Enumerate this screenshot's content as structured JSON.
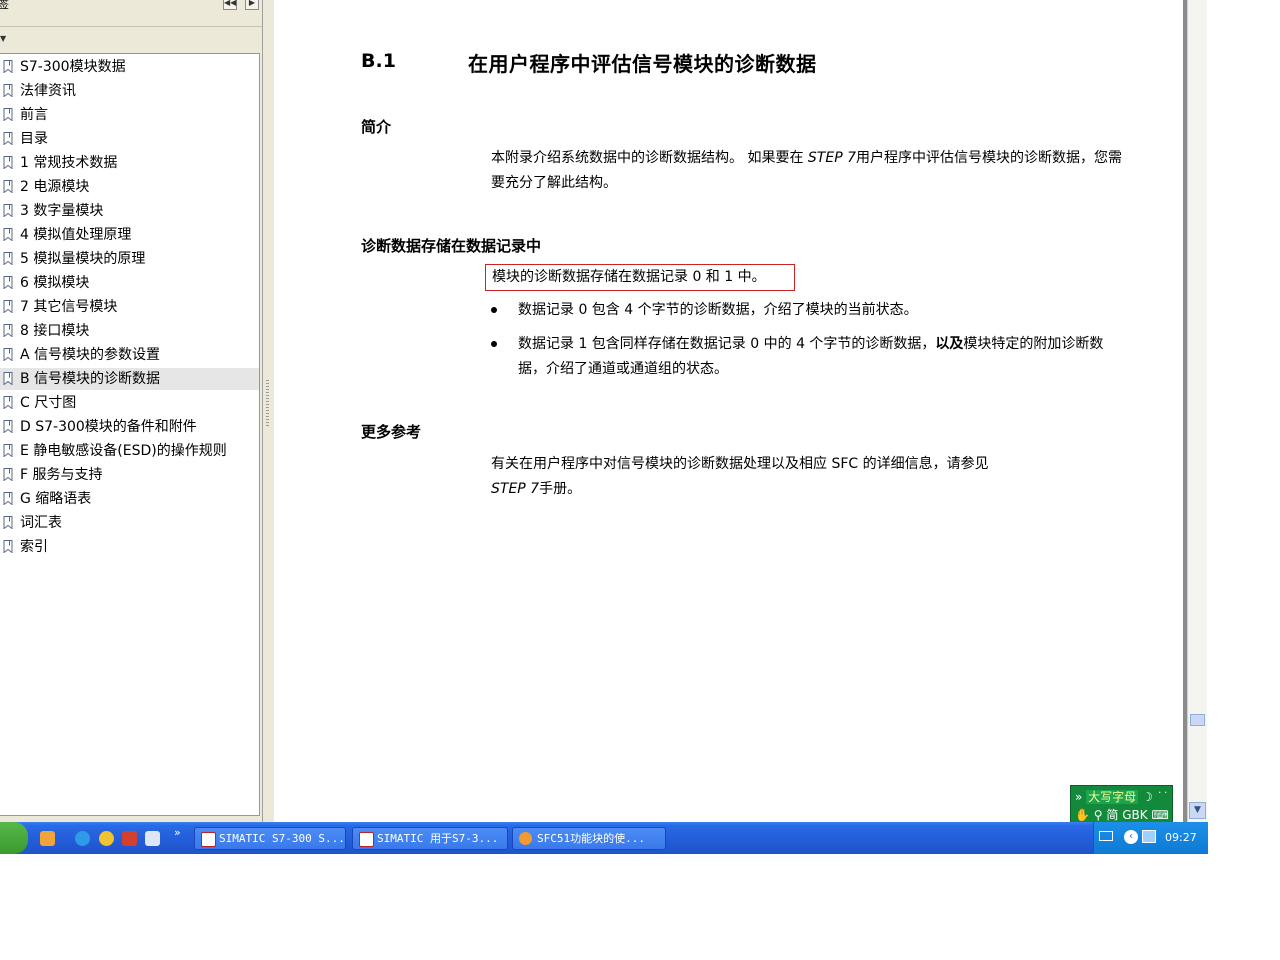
{
  "sidebar": {
    "title": "签",
    "items": [
      {
        "label": "S7-300模块数据"
      },
      {
        "label": "法律资讯"
      },
      {
        "label": "前言"
      },
      {
        "label": "目录"
      },
      {
        "label": "1 常规技术数据"
      },
      {
        "label": "2 电源模块"
      },
      {
        "label": "3 数字量模块"
      },
      {
        "label": "4 模拟值处理原理"
      },
      {
        "label": "5 模拟量模块的原理"
      },
      {
        "label": "6 模拟模块"
      },
      {
        "label": "7 其它信号模块"
      },
      {
        "label": "8 接口模块"
      },
      {
        "label": "A 信号模块的参数设置"
      },
      {
        "label": "B 信号模块的诊断数据"
      },
      {
        "label": "C 尺寸图"
      },
      {
        "label": "D S7-300模块的备件和附件"
      },
      {
        "label": "E 静电敏感设备(ESD)的操作规则"
      },
      {
        "label": "F 服务与支持"
      },
      {
        "label": "G 缩略语表"
      },
      {
        "label": "词汇表"
      },
      {
        "label": "索引"
      }
    ],
    "selected_index": 13
  },
  "document": {
    "section_number": "B.1",
    "section_title": "在用户程序中评估信号模块的诊断数据",
    "intro": {
      "heading": "简介",
      "text_before": "本附录介绍系统数据中的诊断数据结构。 如果要在 ",
      "italic": "STEP 7",
      "text_after": "用户程序中评估信号模块的诊断数据，您需要充分了解此结构。"
    },
    "storage": {
      "heading": "诊断数据存储在数据记录中",
      "highlight": "模块的诊断数据存储在数据记录 0 和 1 中。",
      "bullets": [
        {
          "before": "数据记录 0 包含 4 个字节的诊断数据，介绍了模块的当前状态。",
          "bold": "",
          "after": ""
        },
        {
          "before": "数据记录 1 包含同样存储在数据记录 0 中的 4 个字节的诊断数据，",
          "bold": "以及",
          "after": "模块特定的附加诊断数据，介绍了通道或通道组的状态。"
        }
      ]
    },
    "more": {
      "heading": "更多参考",
      "text_before": "有关在用户程序中对信号模块的诊断数据处理以及相应 SFC 的详细信息，请参见",
      "italic": "STEP 7",
      "text_after": "手册。"
    }
  },
  "ime": {
    "caps": "大写字母",
    "mode": "简",
    "encoding": "GBK"
  },
  "taskbar": {
    "tasks": [
      {
        "label": "SIMATIC S7-300 S...",
        "icon": "pdf-icon"
      },
      {
        "label": "SIMATIC 用于S7-3...",
        "icon": "pdf-icon"
      },
      {
        "label": "SFC51功能块的使...",
        "icon": "browser-icon"
      }
    ],
    "clock": "09:27"
  }
}
